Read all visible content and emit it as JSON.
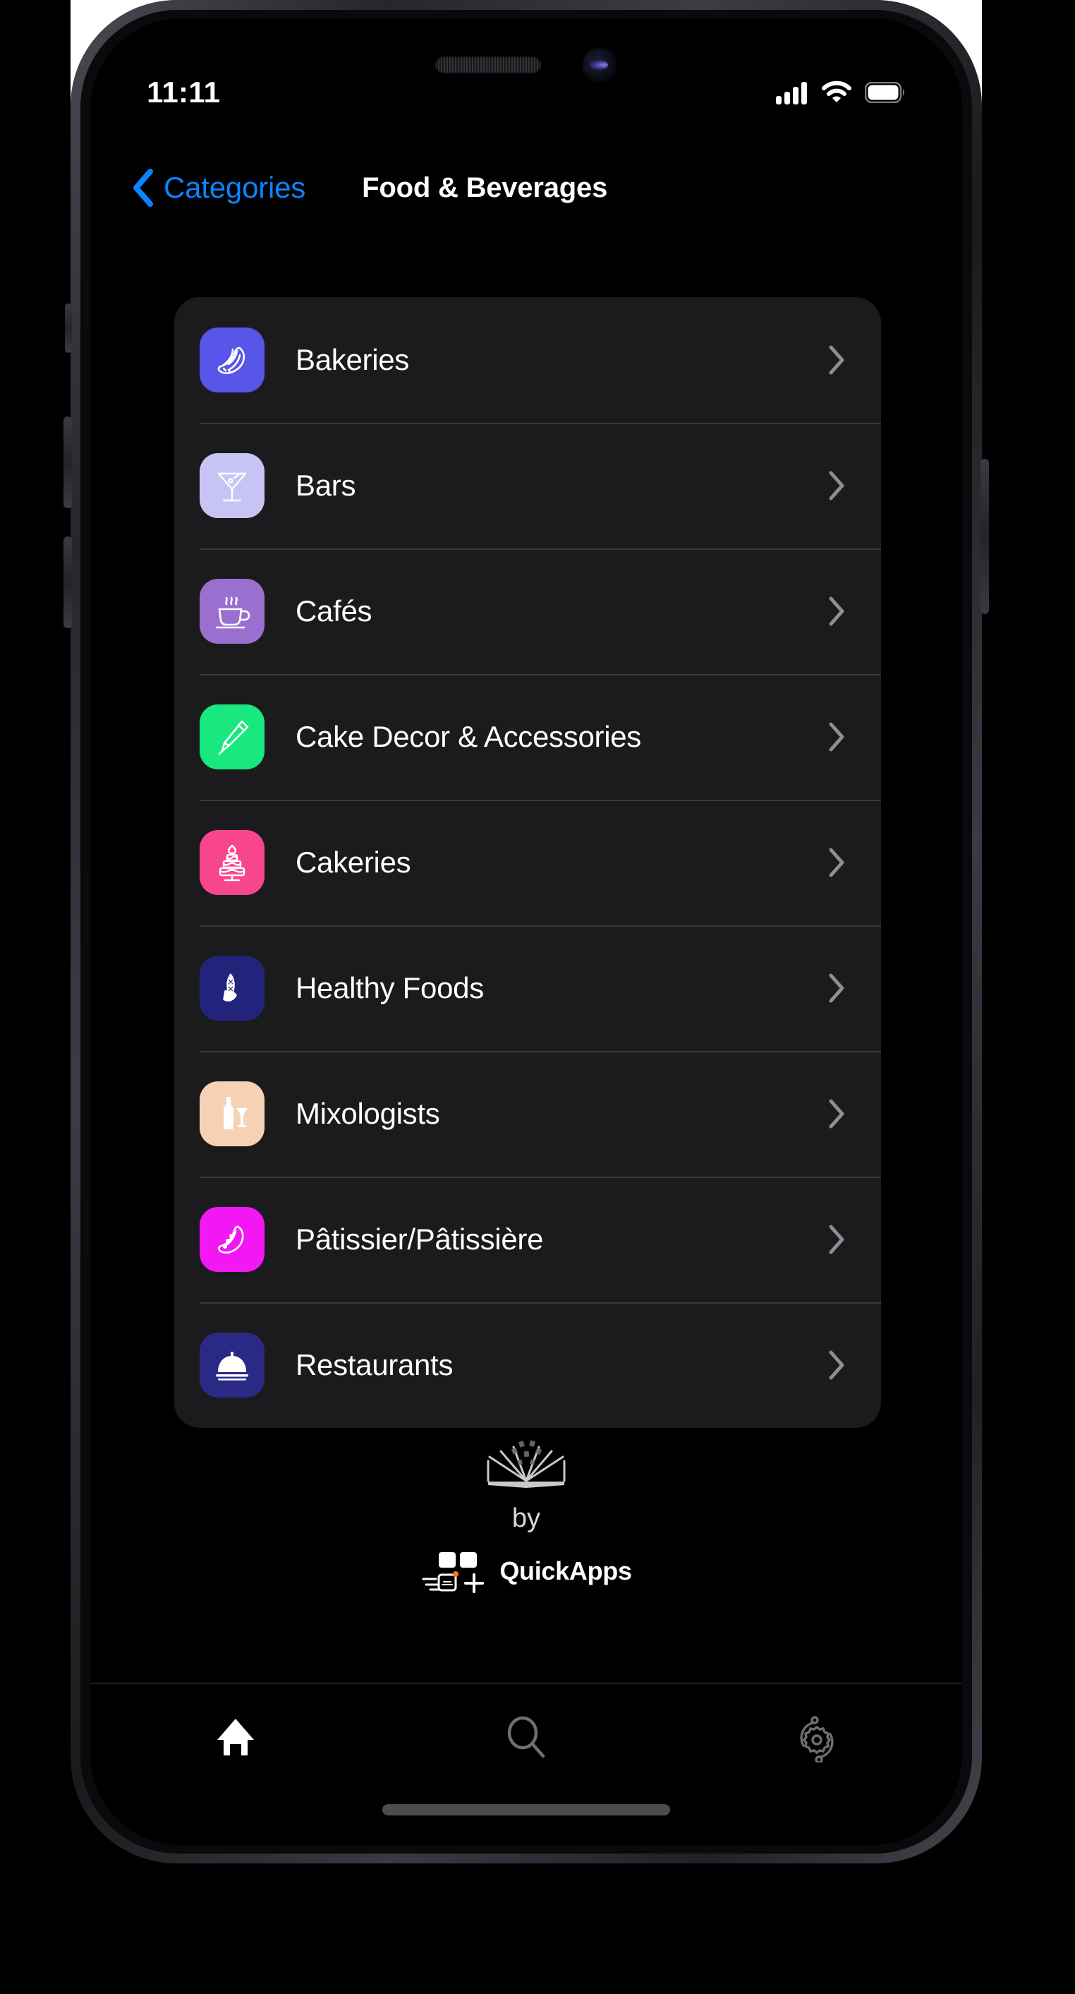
{
  "status_bar": {
    "time": "11:11",
    "signal_icon": "cellular-signal-icon",
    "wifi_icon": "wifi-icon",
    "battery_icon": "battery-full-icon"
  },
  "nav_bar": {
    "back_label": "Categories",
    "back_icon": "chevron-left-icon",
    "title": "Food & Beverages",
    "back_color": "#0a84ff"
  },
  "list": {
    "items": [
      {
        "label": "Bakeries",
        "icon": "croissant-icon",
        "color": "#5856e8"
      },
      {
        "label": "Bars",
        "icon": "cocktail-glass-icon",
        "color": "#c7c4f5"
      },
      {
        "label": "Cafés",
        "icon": "coffee-cup-icon",
        "color": "#9b6fd0"
      },
      {
        "label": "Cake Decor & Accessories",
        "icon": "piping-bag-icon",
        "color": "#18e87d"
      },
      {
        "label": "Cakeries",
        "icon": "tiered-cake-icon",
        "color": "#f7458e"
      },
      {
        "label": "Healthy Foods",
        "icon": "fruit-icon",
        "color": "#22237a"
      },
      {
        "label": "Mixologists",
        "icon": "bottle-glass-icon",
        "color": "#f6d2b4"
      },
      {
        "label": "Pâtissier/Pâtissière",
        "icon": "croissant-icon",
        "color": "#f318f3"
      },
      {
        "label": "Restaurants",
        "icon": "cloche-icon",
        "color": "#2a2a86"
      }
    ],
    "chevron_icon": "chevron-right-icon",
    "card_background": "#1b1b1d"
  },
  "footer": {
    "book_icon": "open-book-icon",
    "by_text": "by",
    "brand_icon": "quickapps-logo-icon",
    "brand_name": "QuickApps"
  },
  "tab_bar": {
    "tabs": [
      {
        "name": "home",
        "icon": "home-icon",
        "active": true
      },
      {
        "name": "search",
        "icon": "search-icon",
        "active": false
      },
      {
        "name": "settings",
        "icon": "gear-icon",
        "active": false
      }
    ],
    "active_color": "#ffffff",
    "inactive_color": "#6e6e73"
  }
}
